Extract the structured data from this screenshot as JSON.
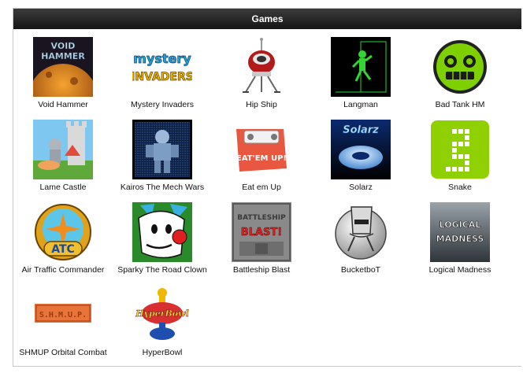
{
  "window": {
    "title": "Games"
  },
  "games": [
    {
      "label": "Void Hammer",
      "icon": "void-hammer-icon"
    },
    {
      "label": "Mystery Invaders",
      "icon": "mystery-invaders-icon"
    },
    {
      "label": "Hip Ship",
      "icon": "hip-ship-icon"
    },
    {
      "label": "Langman",
      "icon": "langman-icon"
    },
    {
      "label": "Bad Tank HM",
      "icon": "bad-tank-icon"
    },
    {
      "label": "Lame Castle",
      "icon": "lame-castle-icon"
    },
    {
      "label": "Kairos The Mech Wars",
      "icon": "kairos-icon"
    },
    {
      "label": "Eat em Up",
      "icon": "eat-em-up-icon"
    },
    {
      "label": "Solarz",
      "icon": "solarz-icon"
    },
    {
      "label": "Snake",
      "icon": "snake-icon"
    },
    {
      "label": "Air Traffic Commander",
      "icon": "air-traffic-commander-icon"
    },
    {
      "label": "Sparky The Road Clown",
      "icon": "sparky-clown-icon"
    },
    {
      "label": "Battleship Blast",
      "icon": "battleship-blast-icon"
    },
    {
      "label": "BucketboT",
      "icon": "bucketbot-icon"
    },
    {
      "label": "Logical Madness",
      "icon": "logical-madness-icon"
    },
    {
      "label": "SHMUP Orbital Combat",
      "icon": "shmup-icon"
    },
    {
      "label": "HyperBowl",
      "icon": "hyperbowl-icon"
    }
  ],
  "logos": {
    "void_hammer": [
      "VOID",
      "HAMMER"
    ],
    "mystery_invaders": [
      "mystery",
      "INVADERS"
    ],
    "eat_em_up": "EAT'EM UP!",
    "solarz": "Solarz",
    "atc": "ATC",
    "battleship": [
      "BATTLESHIP",
      "BLAST!"
    ],
    "logical_madness": [
      "LOGICAL",
      "MADNESS"
    ],
    "shmup": "S.H.M.U.P.",
    "hyperbowl": "HyperBowl"
  }
}
